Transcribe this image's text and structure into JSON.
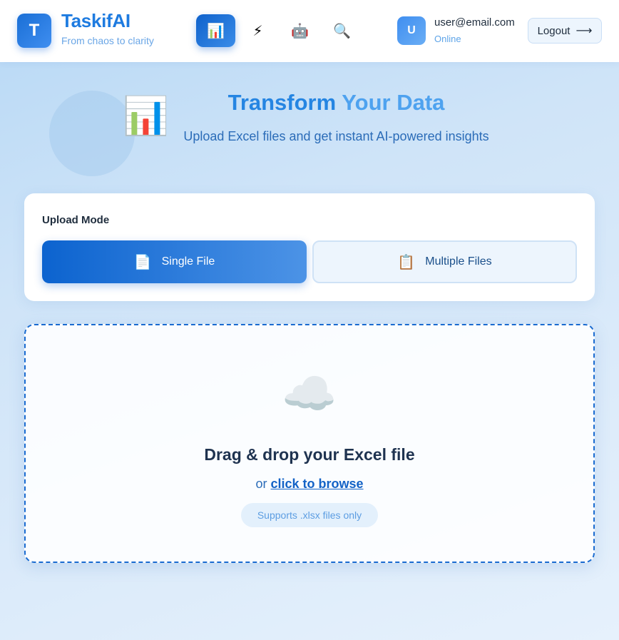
{
  "header": {
    "logo_letter": "T",
    "brand_name": "TaskifAI",
    "tagline": "From chaos to clarity",
    "nav": [
      {
        "icon": "bar-chart-icon",
        "glyph": "📊",
        "active": true
      },
      {
        "icon": "lightning-icon",
        "glyph": "⚡",
        "active": false
      },
      {
        "icon": "robot-icon",
        "glyph": "🤖",
        "active": false
      },
      {
        "icon": "search-icon",
        "glyph": "🔍",
        "active": false
      }
    ],
    "user": {
      "avatar_letter": "U",
      "email": "user@email.com",
      "status": "Online"
    },
    "logout_label": "Logout",
    "logout_arrow": "⟶"
  },
  "hero": {
    "icon_glyph": "📊",
    "title_part1": "Transform",
    "title_part2": "Your Data",
    "subtitle": "Upload Excel files and get instant AI-powered insights"
  },
  "upload_mode": {
    "label": "Upload Mode",
    "single": {
      "icon": "📄",
      "label": "Single File",
      "selected": true
    },
    "multiple": {
      "icon": "📋",
      "label": "Multiple Files",
      "selected": false
    }
  },
  "dropzone": {
    "icon_glyph": "☁️",
    "title": "Drag & drop your Excel file",
    "or_text": "or",
    "browse_label": "click to browse",
    "support_note": "Supports .xlsx files only"
  },
  "colors": {
    "accent": "#1a6fd6",
    "brand_text": "#1e7be0",
    "status_online": "#5ea4e8"
  }
}
